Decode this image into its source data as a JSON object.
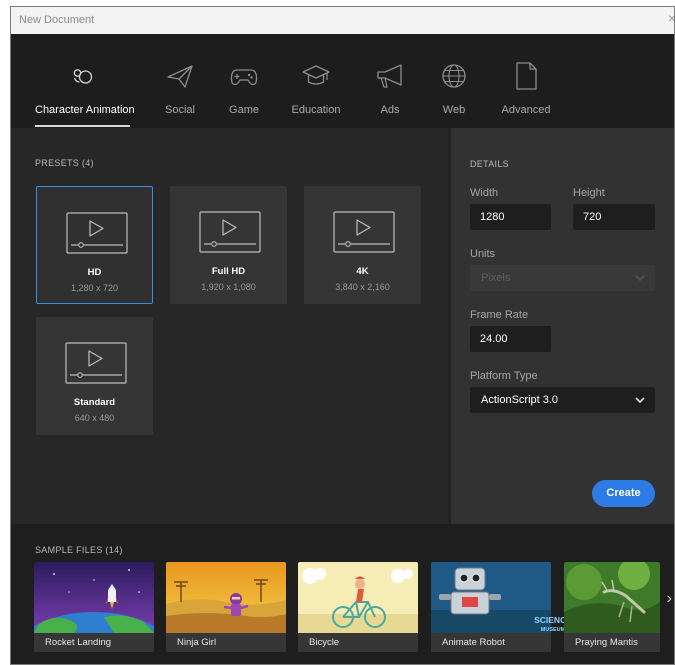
{
  "window": {
    "title": "New Document",
    "close_glyph": "×"
  },
  "categories": [
    {
      "label": "Character Animation",
      "icon": "character-animation-icon",
      "active": true
    },
    {
      "label": "Social",
      "icon": "paper-plane-icon"
    },
    {
      "label": "Game",
      "icon": "gamepad-icon"
    },
    {
      "label": "Education",
      "icon": "graduation-cap-icon"
    },
    {
      "label": "Ads",
      "icon": "megaphone-icon"
    },
    {
      "label": "Web",
      "icon": "globe-icon"
    },
    {
      "label": "Advanced",
      "icon": "blank-document-icon"
    }
  ],
  "presets": {
    "title": "PRESETS (4)",
    "items": [
      {
        "name": "HD",
        "size": "1,280 x 720",
        "selected": true
      },
      {
        "name": "Full HD",
        "size": "1,920 x 1,080"
      },
      {
        "name": "4K",
        "size": "3,840 x 2,160"
      },
      {
        "name": "Standard",
        "size": "640 x 480"
      }
    ]
  },
  "details": {
    "title": "DETAILS",
    "width_label": "Width",
    "width_value": "1280",
    "height_label": "Height",
    "height_value": "720",
    "units_label": "Units",
    "units_value": "Pixels",
    "frame_rate_label": "Frame Rate",
    "frame_rate_value": "24.00",
    "platform_label": "Platform Type",
    "platform_value": "ActionScript 3.0",
    "create_label": "Create"
  },
  "samples": {
    "title": "SAMPLE FILES (14)",
    "items": [
      {
        "caption": "Rocket Landing"
      },
      {
        "caption": "Ninja Girl"
      },
      {
        "caption": "Bicycle"
      },
      {
        "caption": "Animate Robot",
        "badge_line1": "SCIENCE",
        "badge_line2": "MUSEUM"
      },
      {
        "caption": "Praying Mantis"
      }
    ],
    "next_glyph": "›"
  },
  "colors": {
    "accent": "#2d7be4",
    "selected_border": "#3d8de0",
    "background": "#232323"
  }
}
